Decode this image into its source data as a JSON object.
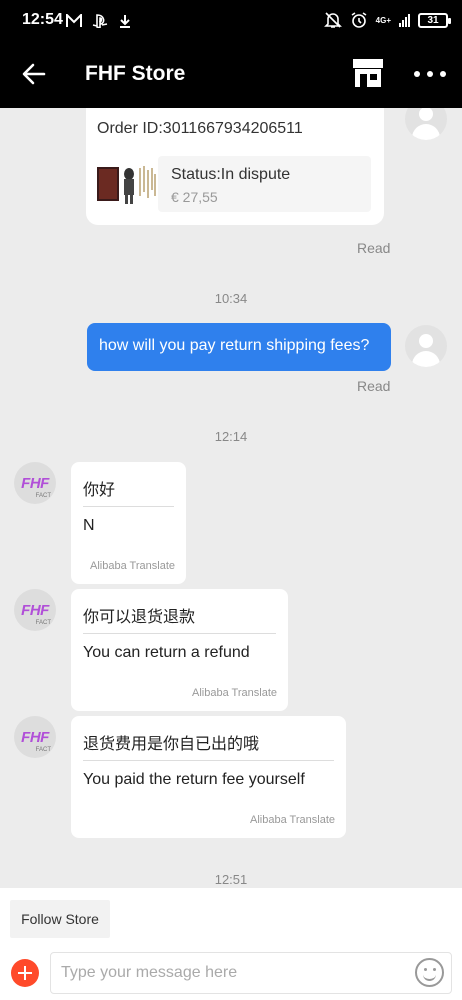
{
  "status_bar": {
    "time": "12:54",
    "network": "4G+",
    "battery": "31",
    "icons": [
      "mail-icon",
      "playstation-icon",
      "download-icon",
      "silent-icon",
      "alarm-icon",
      "signal-icon",
      "battery-icon"
    ]
  },
  "header": {
    "title": "FHF Store",
    "icons": [
      "back-arrow-icon",
      "store-icon",
      "more-icon"
    ]
  },
  "order": {
    "id_text": "Order ID:3011667934206511",
    "status": "Status:In dispute",
    "price": "€ 27,55",
    "read": "Read"
  },
  "messages": [
    {
      "type": "timestamp",
      "text": "10:34"
    },
    {
      "type": "outgoing",
      "text": "how will you pay return shipping fees?",
      "read": "Read"
    },
    {
      "type": "timestamp",
      "text": "12:14"
    },
    {
      "type": "incoming",
      "original": "你好",
      "translation": "N",
      "attribution": "Alibaba Translate"
    },
    {
      "type": "incoming",
      "original": "你可以退货退款",
      "translation": "You can return a refund",
      "attribution": "Alibaba Translate"
    },
    {
      "type": "incoming",
      "original": "退货费用是你自已出的哦",
      "translation": "You paid the return fee yourself",
      "attribution": "Alibaba Translate"
    },
    {
      "type": "timestamp",
      "text": "12:51"
    }
  ],
  "store_avatar": {
    "logo": "FHF",
    "sub": "FACT"
  },
  "bottom": {
    "follow_label": "Follow Store",
    "input_placeholder": "Type your message here"
  },
  "colors": {
    "header_bg": "#000000",
    "outgoing_bubble": "#2f80ed",
    "chat_bg": "#ececec",
    "plus_button": "#ff4a2a",
    "store_logo": "#b14fd8"
  }
}
